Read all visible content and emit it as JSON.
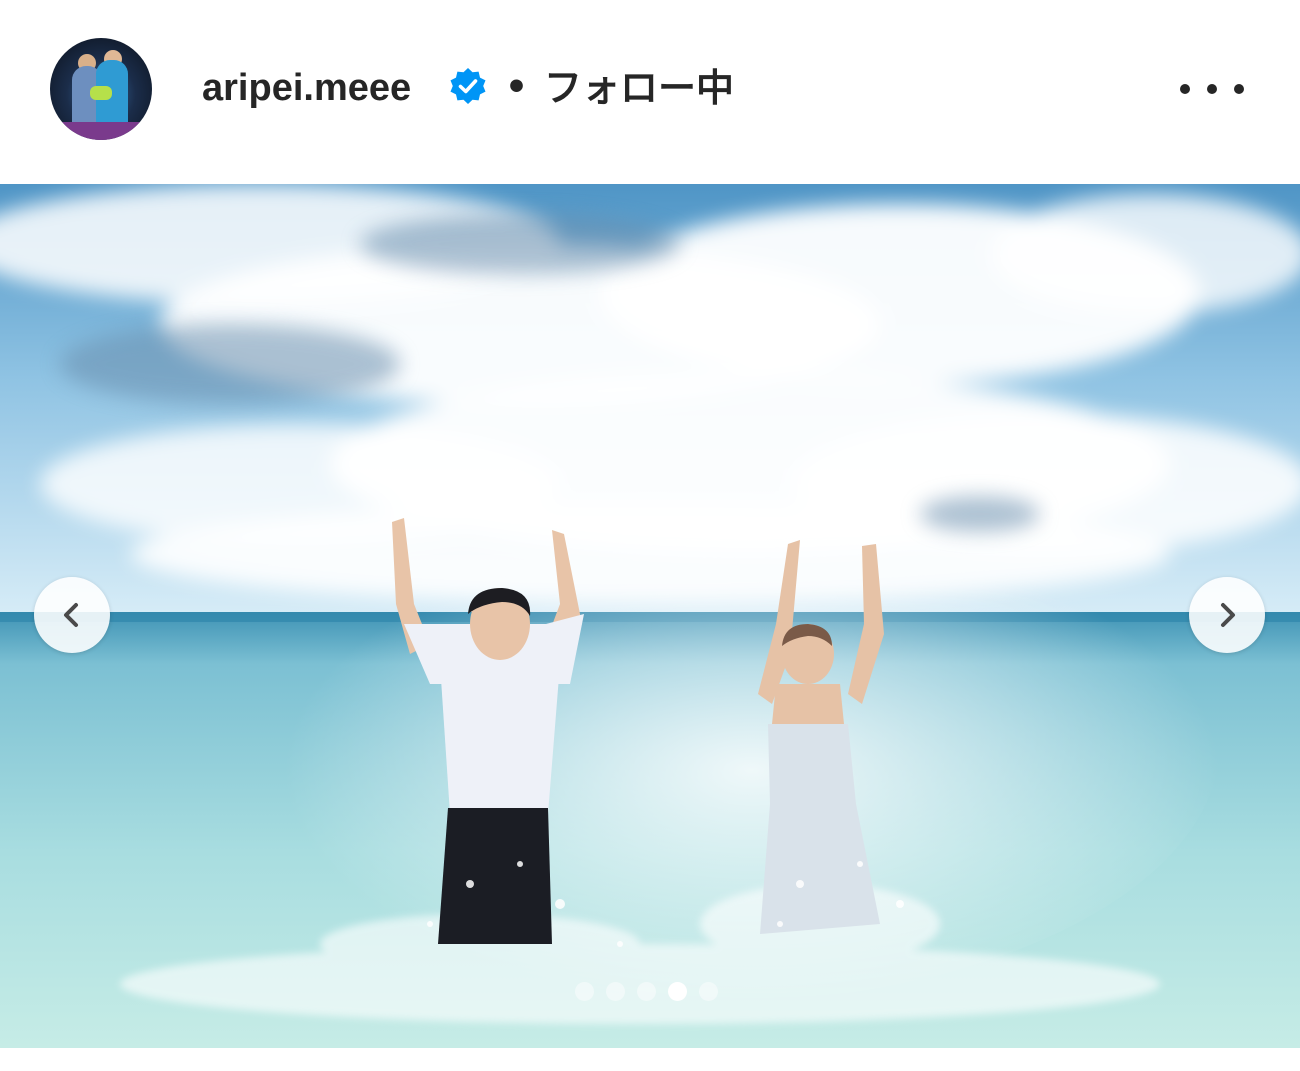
{
  "post": {
    "username": "aripei.meee",
    "separator": "•",
    "follow_status": "フォロー中",
    "more_icon": "more-horizontal-icon",
    "verified_icon": "verified-badge-icon",
    "verified_color": "#0095f6"
  },
  "carousel": {
    "prev_icon": "chevron-left-icon",
    "next_icon": "chevron-right-icon",
    "slide_count": 5,
    "active_slide": 4
  }
}
